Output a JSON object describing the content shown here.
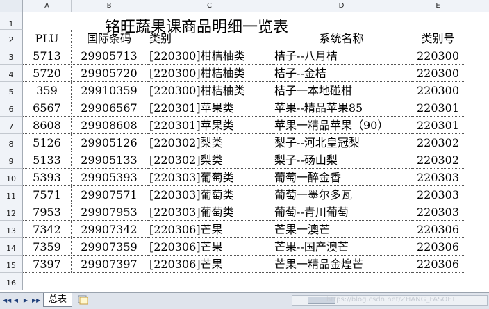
{
  "columns": [
    "A",
    "B",
    "C",
    "D",
    "E"
  ],
  "title": "铭旺蔬果课商品明细一览表",
  "header": [
    "PLU",
    "国际条码",
    "类别",
    "系统名称",
    "类别号"
  ],
  "rows": [
    [
      "5713",
      "29905713",
      "[220300]柑桔柚类",
      "桔子--八月桔",
      "220300"
    ],
    [
      "5720",
      "29905720",
      "[220300]柑桔柚类",
      "桔子--金桔",
      "220300"
    ],
    [
      "359",
      "29910359",
      "[220300]柑桔柚类",
      "桔子一本地碰柑",
      "220300"
    ],
    [
      "6567",
      "29906567",
      "[220301]苹果类",
      "苹果--精品苹果85",
      "220301"
    ],
    [
      "8608",
      "29908608",
      "[220301]苹果类",
      "苹果一精品苹果（90）",
      "220301"
    ],
    [
      "5126",
      "29905126",
      "[220302]梨类",
      "梨子--河北皇冠梨",
      "220302"
    ],
    [
      "5133",
      "29905133",
      "[220302]梨类",
      "梨子--砀山梨",
      "220302"
    ],
    [
      "5393",
      "29905393",
      "[220303]葡萄类",
      "葡萄一醉金香",
      "220303"
    ],
    [
      "7571",
      "29907571",
      "[220303]葡萄类",
      "葡萄一墨尔多瓦",
      "220303"
    ],
    [
      "7953",
      "29907953",
      "[220303]葡萄类",
      "葡萄--青川葡萄",
      "220303"
    ],
    [
      "7342",
      "29907342",
      "[220306]芒果",
      "芒果一澳芒",
      "220306"
    ],
    [
      "7359",
      "29907359",
      "[220306]芒果",
      "芒果--国产澳芒",
      "220306"
    ],
    [
      "7397",
      "29907397",
      "[220306]芒果",
      "芒果一精品金煌芒",
      "220306"
    ]
  ],
  "row_numbers": [
    "1",
    "2",
    "3",
    "4",
    "5",
    "6",
    "7",
    "8",
    "9",
    "10",
    "11",
    "12",
    "13",
    "14",
    "15",
    "16"
  ],
  "sheet_tab": "总表",
  "nav_icons": [
    "first-sheet-icon",
    "prev-sheet-icon",
    "next-sheet-icon",
    "last-sheet-icon"
  ],
  "watermark": "https://blog.csdn.net/ZHANG_FASOFT",
  "colors": {
    "header_bg": "#f0f3f8",
    "grid_line": "#555555",
    "tabbar_bg": "#dfe4ec"
  }
}
